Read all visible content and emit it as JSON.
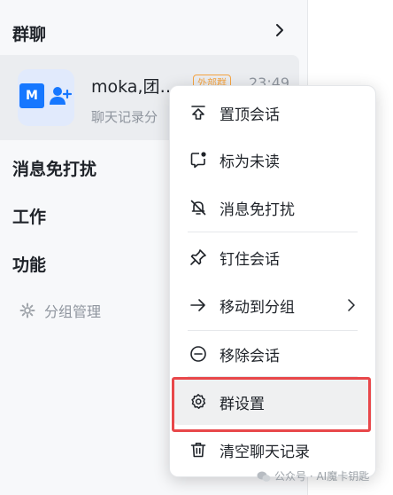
{
  "sections": {
    "group_chat": "群聊",
    "dnd": "消息免打扰",
    "work": "工作",
    "features": "功能"
  },
  "chat": {
    "avatar_letter": "M",
    "name": "moka,团…",
    "badge": "外部群",
    "time": "23:49",
    "preview": "聊天记录分"
  },
  "group_manage": "分组管理",
  "context_menu": {
    "pin_top": "置顶会话",
    "mark_unread": "标为未读",
    "mute": "消息免打扰",
    "pin_chat": "钉住会话",
    "move_to_group": "移动到分组",
    "remove_chat": "移除会话",
    "group_settings": "群设置",
    "clear_history": "清空聊天记录"
  },
  "watermark": "公众号 · AI魔卡钥匙"
}
